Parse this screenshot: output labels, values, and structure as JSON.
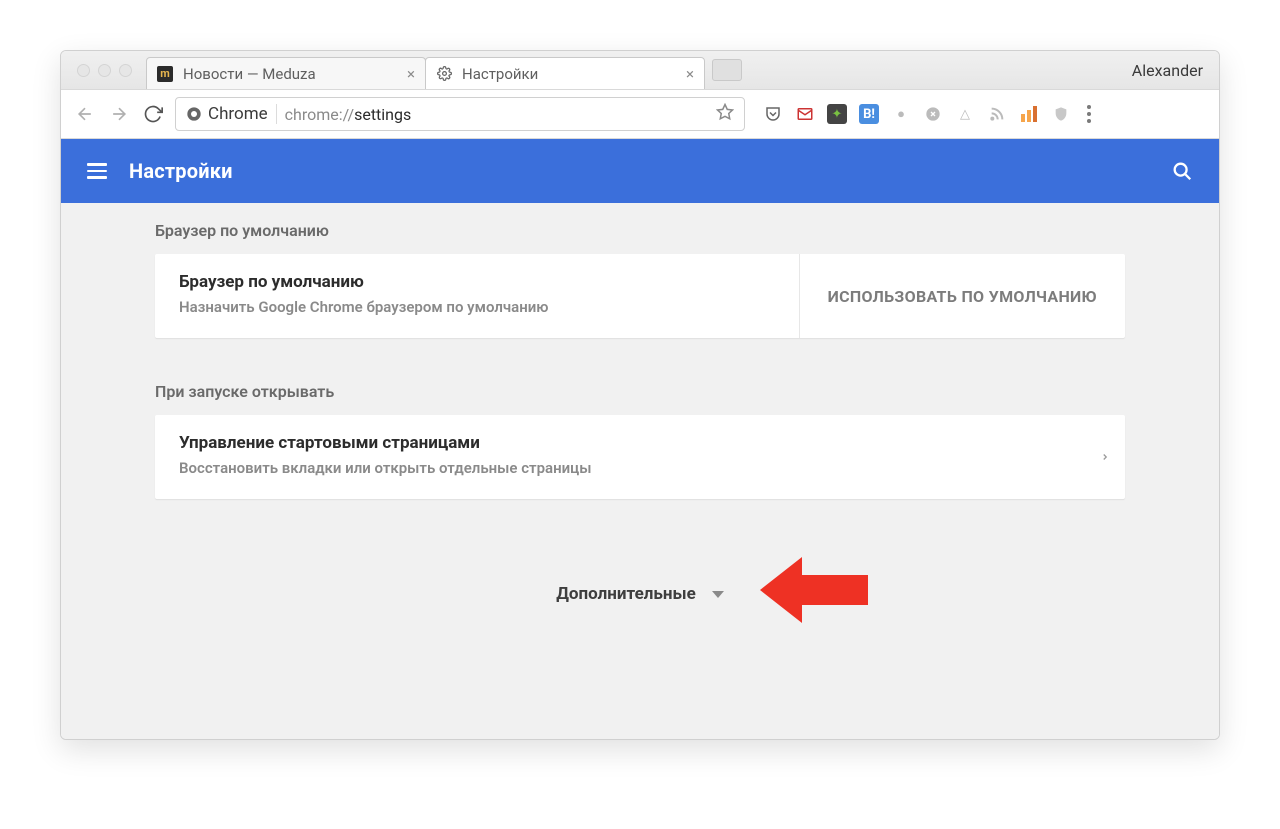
{
  "window": {
    "profile_name": "Alexander",
    "tabs": [
      {
        "title": "Новости — Meduza"
      },
      {
        "title": "Настройки"
      }
    ]
  },
  "toolbar": {
    "chrome_chip": "Chrome",
    "url_scheme": "chrome://",
    "url_path": "settings"
  },
  "header": {
    "title": "Настройки"
  },
  "sections": {
    "default_browser": {
      "heading": "Браузер по умолчанию",
      "card_title": "Браузер по умолчанию",
      "card_sub": "Назначить Google Chrome браузером по умолчанию",
      "action": "ИСПОЛЬЗОВАТЬ ПО УМОЛЧАНИЮ"
    },
    "on_startup": {
      "heading": "При запуске открывать",
      "card_title": "Управление стартовыми страницами",
      "card_sub": "Восстановить вкладки или открыть отдельные страницы"
    },
    "advanced": {
      "label": "Дополнительные"
    }
  }
}
